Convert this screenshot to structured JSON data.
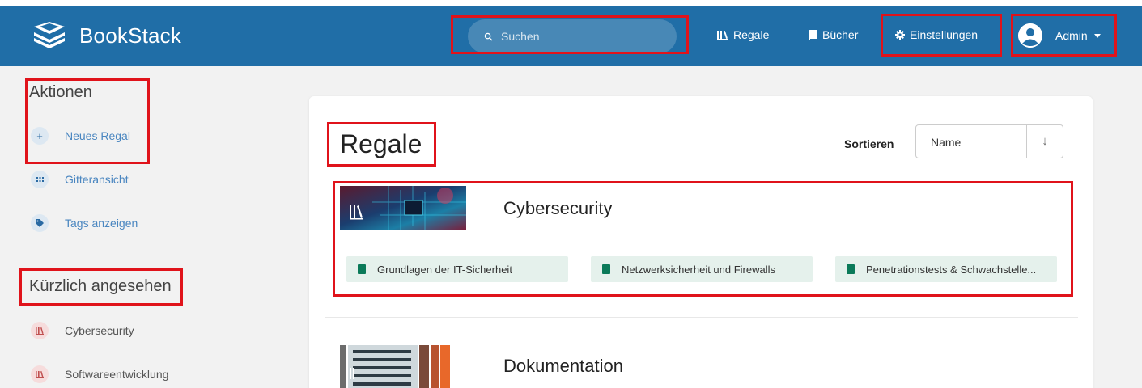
{
  "app": {
    "name": "BookStack"
  },
  "header": {
    "search_placeholder": "Suchen",
    "nav": {
      "shelves": "Regale",
      "books": "Bücher",
      "settings": "Einstellungen"
    },
    "user": {
      "name": "Admin"
    }
  },
  "sidebar": {
    "actions_heading": "Aktionen",
    "actions": [
      {
        "label": "Neues Regal",
        "icon": "plus-icon"
      },
      {
        "label": "Gitteransicht",
        "icon": "grid-icon"
      },
      {
        "label": "Tags anzeigen",
        "icon": "tag-icon"
      }
    ],
    "recent_heading": "Kürzlich angesehen",
    "recent": [
      {
        "label": "Cybersecurity",
        "icon": "shelf-icon"
      },
      {
        "label": "Softwareentwicklung",
        "icon": "shelf-icon"
      }
    ]
  },
  "main": {
    "title": "Regale",
    "sort": {
      "label": "Sortieren",
      "value": "Name",
      "direction_icon": "↓"
    },
    "shelves": [
      {
        "name": "Cybersecurity",
        "books": [
          "Grundlagen der IT-Sicherheit",
          "Netzwerksicherheit und Firewalls",
          "Penetrationstests & Schwachstelle..."
        ]
      },
      {
        "name": "Dokumentation",
        "books": []
      }
    ]
  },
  "colors": {
    "header": "#206ea7",
    "highlight": "#e0131b",
    "book_chip": "#e5f1ec",
    "book_icon": "#0b7a59"
  }
}
